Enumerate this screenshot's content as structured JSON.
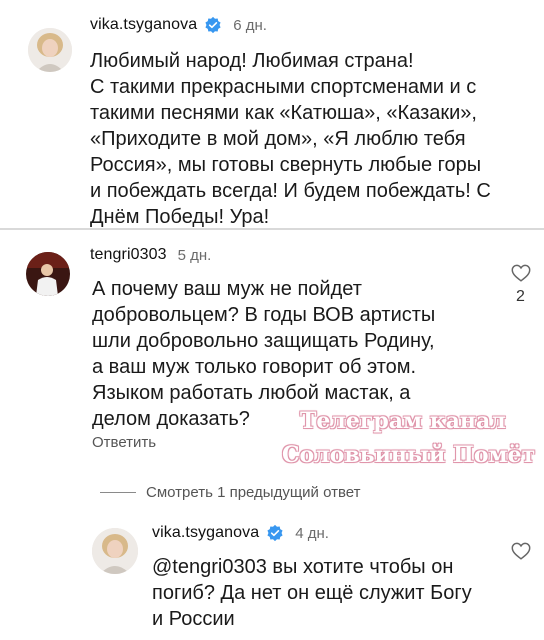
{
  "comments": [
    {
      "username": "vika.tsyganova",
      "verified": true,
      "time": "6 дн.",
      "text": "Любимый народ! Любимая страна!\nС такими прекрасными спортсменами и с\nтакими песнями как «Катюша», «Казаки»,\n«Приходите в мой дом», «Я люблю тебя\nРоссия», мы готовы свернуть любые горы\nи побеждать всегда! И будем побеждать! С\nДнём Победы! Ура!"
    },
    {
      "username": "tengri0303",
      "verified": false,
      "time": "5 дн.",
      "text": "А  почему ваш муж не пойдет\nдобровольцем? В годы ВОВ артисты\nшли добровольно защищать Родину,\nа ваш муж только говорит об этом.\nЯзыком работать любой мастак, а\nделом доказать?",
      "likes": "2",
      "reply_label": "Ответить",
      "view_replies_label": "Смотреть 1 предыдущий ответ"
    },
    {
      "username": "vika.tsyganova",
      "verified": true,
      "time": "4 дн.",
      "text": "@tengri0303 вы хотите чтобы он\nпогиб? Да нет он ещё служит Богу\nи России"
    }
  ],
  "watermark": {
    "line1": "Телеграм канал",
    "line2": "Соловьиный Помёт"
  },
  "icons": {
    "verified": "verified-badge-icon",
    "like": "heart-outline-icon"
  },
  "colors": {
    "verified_blue": "#3897f0",
    "watermark_outline": "#e39bb0"
  }
}
